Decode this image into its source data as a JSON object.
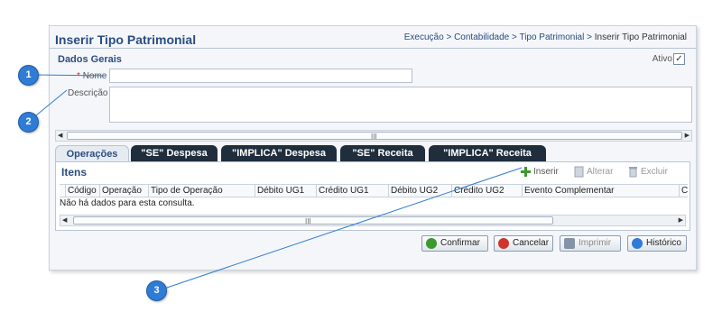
{
  "header": {
    "title": "Inserir Tipo Patrimonial",
    "breadcrumb": "Execução > Contabilidade > Tipo Patrimonial > ",
    "breadcrumb_current": "Inserir Tipo Patrimonial"
  },
  "section": {
    "title": "Dados Gerais",
    "ativo_label": "Ativo",
    "ativo_checked": "✓"
  },
  "form": {
    "nome_required": "*",
    "nome_label": "Nome",
    "nome_value": "",
    "descricao_label": "Descrição",
    "descricao_value": ""
  },
  "tabs": [
    {
      "label": "Operações"
    },
    {
      "label": "\"SE\" Despesa"
    },
    {
      "label": "\"IMPLICA\" Despesa"
    },
    {
      "label": "\"SE\" Receita"
    },
    {
      "label": "\"IMPLICA\" Receita"
    }
  ],
  "itens": {
    "title": "Itens",
    "inserir": "Inserir",
    "alterar": "Alterar",
    "excluir": "Excluir",
    "columns": [
      "Código",
      "Operação",
      "Tipo de Operação",
      "Débito UG1",
      "Crédito UG1",
      "Débito UG2",
      "Crédito UG2",
      "Evento Complementar",
      "C"
    ],
    "empty_text": "Não há dados para esta consulta."
  },
  "actions": {
    "confirmar": "Confirmar",
    "cancelar": "Cancelar",
    "imprimir": "Imprimir",
    "historico": "Histórico"
  },
  "callouts": [
    "1",
    "2",
    "3"
  ],
  "scroll_grip": "III",
  "colors": {
    "accent": "#2b4d80",
    "callout": "#2f7cd6",
    "tab_dark": "#1f2d3d"
  }
}
